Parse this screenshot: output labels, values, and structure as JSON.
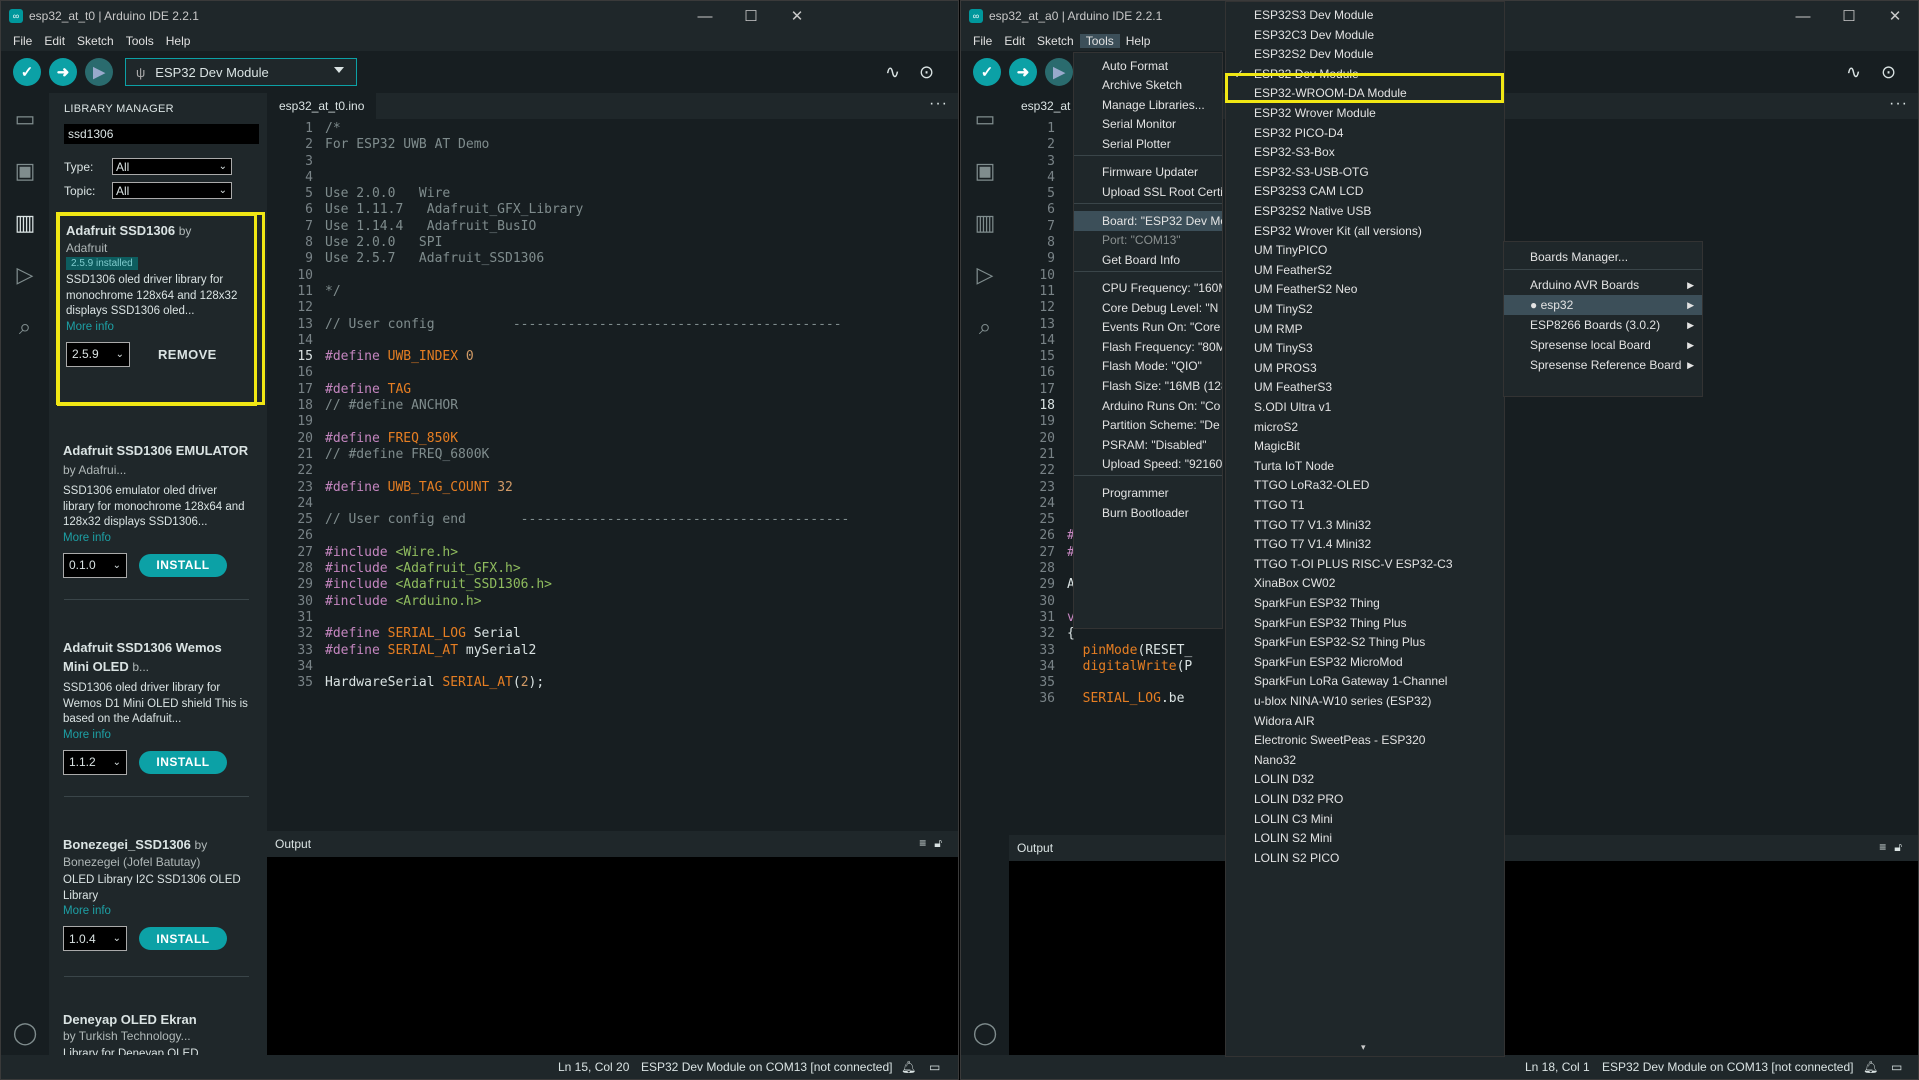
{
  "colors": {
    "accent": "#0ca1a6",
    "highlight": "#f1e714",
    "background": "#171e21",
    "panel": "#1f272a"
  },
  "left_window": {
    "title": "esp32_at_t0 | Arduino IDE 2.2.1",
    "menu": [
      "File",
      "Edit",
      "Sketch",
      "Tools",
      "Help"
    ],
    "board_select": "ESP32 Dev Module",
    "library_manager": {
      "title": "LIBRARY MANAGER",
      "search_value": "ssd1306",
      "type_label": "Type:",
      "type_value": "All",
      "topic_label": "Topic:",
      "topic_value": "All",
      "cards": [
        {
          "name": "Adafruit SSD1306",
          "by": "by",
          "author": "Adafruit",
          "badge": "2.5.9 installed",
          "desc": "SSD1306 oled driver library for monochrome 128x64 and 128x32 displays SSD1306 oled...",
          "more": "More info",
          "version": "2.5.9",
          "action": "REMOVE"
        },
        {
          "name": "Adafruit SSD1306 EMULATOR",
          "by": "by Adafrui...",
          "desc": "SSD1306 emulator oled driver library for monochrome 128x64 and 128x32 displays SSD1306...",
          "more": "More info",
          "version": "0.1.0",
          "action": "INSTALL"
        },
        {
          "name": "Adafruit SSD1306 Wemos Mini OLED",
          "by": "b...",
          "desc": "SSD1306 oled driver library for Wemos D1 Mini OLED shield This is based on the Adafruit...",
          "more": "More info",
          "version": "1.1.2",
          "action": "INSTALL"
        },
        {
          "name": "Bonezegei_SSD1306",
          "by": "by",
          "author": "Bonezegei (Jofel Batutay)",
          "desc": "OLED Library I2C SSD1306 OLED Library",
          "more": "More info",
          "version": "1.0.4",
          "action": "INSTALL"
        },
        {
          "name": "Deneyap OLED Ekran",
          "author": "by Turkish Technology...",
          "desc": "Library for Deneyap OLED"
        }
      ]
    },
    "tab": "esp32_at_t0.ino",
    "output_label": "Output",
    "status": {
      "position": "Ln 15, Col 20",
      "board": "ESP32 Dev Module on COM13 [not connected]"
    }
  },
  "code": [
    "/*",
    "For ESP32 UWB AT Demo",
    "",
    "",
    "Use 2.0.0   Wire",
    "Use 1.11.7   Adafruit_GFX_Library",
    "Use 1.14.4   Adafruit_BusIO",
    "Use 2.0.0   SPI",
    "Use 2.5.7   Adafruit_SSD1306",
    "",
    "*/",
    "",
    "// User config          ------------------------------------------",
    "",
    "#define UWB_INDEX 0",
    "",
    "#define TAG",
    "// #define ANCHOR",
    "",
    "#define FREQ_850K",
    "// #define FREQ_6800K",
    "",
    "#define UWB_TAG_COUNT 32",
    "",
    "// User config end       ------------------------------------------",
    "",
    "#include <Wire.h>",
    "#include <Adafruit_GFX.h>",
    "#include <Adafruit_SSD1306.h>",
    "#include <Arduino.h>",
    "",
    "#define SERIAL_LOG Serial",
    "#define SERIAL_AT mySerial2",
    "",
    "HardwareSerial SERIAL_AT(2);"
  ],
  "right_window": {
    "title": "esp32_at_a0 | Arduino IDE 2.2.1",
    "menu": [
      "File",
      "Edit",
      "Sketch",
      "Tools",
      "Help"
    ],
    "tab": "esp32_at",
    "output_label": "Output",
    "visible_code": {
      "26": "#define I2C_SDA 4",
      "27": "#define I2C_SCL 5",
      "29": "Adafruit_SSD1306 d",
      "31": "void setup()",
      "32": "{",
      "33": "  pinMode(RESET_",
      "34": "  digitalWrite(P",
      "36": "  SERIAL_LOG.be"
    },
    "status": {
      "position": "Ln 18, Col 1",
      "board": "ESP32 Dev Module on COM13 [not connected]"
    },
    "tools_menu": [
      "Auto Format",
      "Archive Sketch",
      "Manage Libraries...",
      "Serial Monitor",
      "Serial Plotter",
      "Firmware Updater",
      "Upload SSL Root Certi",
      "Board: \"ESP32 Dev Mo",
      "Port: \"COM13\"",
      "Get Board Info",
      "CPU Frequency: \"160M",
      "Core Debug Level: \"N",
      "Events Run On: \"Core",
      "Flash Frequency: \"80M",
      "Flash Mode: \"QIO\"",
      "Flash Size: \"16MB (128",
      "Arduino Runs On: \"Co",
      "Partition Scheme: \"De",
      "PSRAM: \"Disabled\"",
      "Upload Speed: \"92160",
      "Programmer",
      "Burn Bootloader"
    ],
    "boards_menu": [
      "Boards Manager...",
      "Arduino AVR Boards",
      "esp32",
      "ESP8266 Boards (3.0.2)",
      "Spresense local Board",
      "Spresense Reference Board"
    ],
    "esp32_boards": [
      "ESP32S3 Dev Module",
      "ESP32C3 Dev Module",
      "ESP32S2 Dev Module",
      "ESP32 Dev Module",
      "ESP32-WROOM-DA Module",
      "ESP32 Wrover Module",
      "ESP32 PICO-D4",
      "ESP32-S3-Box",
      "ESP32-S3-USB-OTG",
      "ESP32S3 CAM LCD",
      "ESP32S2 Native USB",
      "ESP32 Wrover Kit (all versions)",
      "UM TinyPICO",
      "UM FeatherS2",
      "UM FeatherS2 Neo",
      "UM TinyS2",
      "UM RMP",
      "UM TinyS3",
      "UM PROS3",
      "UM FeatherS3",
      "S.ODI Ultra v1",
      "microS2",
      "MagicBit",
      "Turta IoT Node",
      "TTGO LoRa32-OLED",
      "TTGO T1",
      "TTGO T7 V1.3 Mini32",
      "TTGO T7 V1.4 Mini32",
      "TTGO T-OI PLUS RISC-V ESP32-C3",
      "XinaBox CW02",
      "SparkFun ESP32 Thing",
      "SparkFun ESP32 Thing Plus",
      "SparkFun ESP32-S2 Thing Plus",
      "SparkFun ESP32 MicroMod",
      "SparkFun LoRa Gateway 1-Channel",
      "u-blox NINA-W10 series (ESP32)",
      "Widora AIR",
      "Electronic SweetPeas - ESP320",
      "Nano32",
      "LOLIN D32",
      "LOLIN D32 PRO",
      "LOLIN C3 Mini",
      "LOLIN S2 Mini",
      "LOLIN S2 PICO"
    ]
  }
}
